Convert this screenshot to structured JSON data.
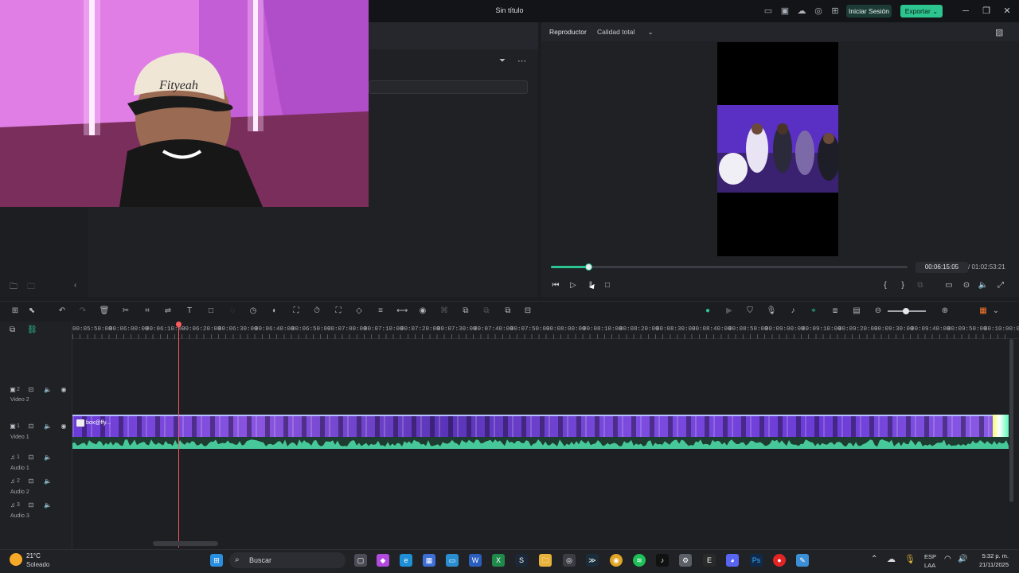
{
  "window": {
    "title": "Sin título",
    "login_label": "Iniciar Sesión",
    "export_label": "Exportar"
  },
  "player": {
    "label": "Reproductor",
    "quality": "Calidad total",
    "current_time": "00:06:15:05",
    "total_time": "/ 01:02:53:21",
    "progress": 0.1
  },
  "ruler": {
    "ticks": [
      "00:05:50:00",
      "00:06:00:00",
      "00:06:10:00",
      "00:06:20:00",
      "00:06:30:00",
      "00:06:40:00",
      "00:06:50:00",
      "00:07:00:00",
      "00:07:10:00",
      "00:07:20:00",
      "00:07:30:00",
      "00:07:40:00",
      "00:07:50:00",
      "00:08:00:00",
      "00:08:10:00",
      "00:08:20:00",
      "00:08:30:00",
      "00:08:40:00",
      "00:08:50:00",
      "00:09:00:00",
      "00:09:10:00",
      "00:09:20:00",
      "00:09:30:00",
      "00:09:40:00",
      "00:09:50:00",
      "00:10:00:00"
    ]
  },
  "tracks": {
    "video2": {
      "num": "2",
      "name": "Video 2"
    },
    "video1": {
      "num": "1",
      "name": "Video 1"
    },
    "audio1": {
      "num": "1",
      "name": "Audio 1"
    },
    "audio2": {
      "num": "2",
      "name": "Audio 2"
    },
    "audio3": {
      "num": "3",
      "name": "Audio 3"
    }
  },
  "clip": {
    "label": "box@ffy..."
  },
  "taskbar": {
    "temp": "21°C",
    "condition": "Soleado",
    "search": "Buscar",
    "lang1": "ESP",
    "lang2": "LAA",
    "time": "5:32 p. m.",
    "date": "21/11/2025"
  },
  "colors": {
    "accent": "#2dc58f",
    "playhead": "#ff5b5b",
    "clip": "#6a3bd6"
  }
}
